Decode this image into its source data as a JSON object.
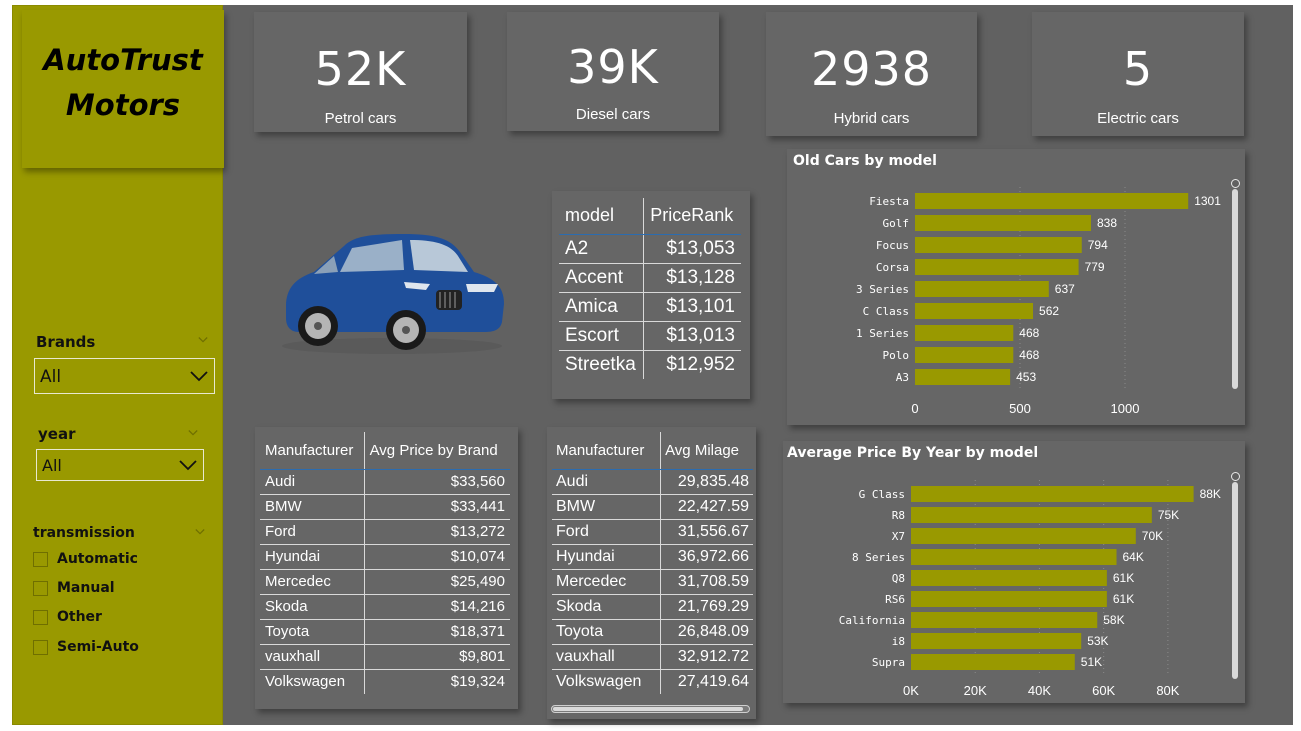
{
  "sidebar": {
    "logo_title": "AutoTrust\nMotors",
    "brands": {
      "title": "Brands",
      "value": "All"
    },
    "year": {
      "title": "year",
      "value": "All"
    },
    "transmission": {
      "title": "transmission",
      "options": [
        "Automatic",
        "Manual",
        "Other",
        "Semi-Auto"
      ]
    }
  },
  "kpis": [
    {
      "value": "52K",
      "label": "Petrol cars"
    },
    {
      "value": "39K",
      "label": "Diesel cars"
    },
    {
      "value": "2938",
      "label": "Hybrid cars"
    },
    {
      "value": "5",
      "label": "Electric cars"
    }
  ],
  "rank_table": {
    "headers": [
      "model",
      "PriceRank"
    ],
    "rows": [
      [
        "A2",
        "$13,053"
      ],
      [
        "Accent",
        "$13,128"
      ],
      [
        "Amica",
        "$13,101"
      ],
      [
        "Escort",
        "$13,013"
      ],
      [
        "Streetka",
        "$12,952"
      ]
    ]
  },
  "brand_table": {
    "headers": [
      "Manufacturer",
      "Avg Price by Brand"
    ],
    "rows": [
      [
        "Audi",
        "$33,560"
      ],
      [
        "BMW",
        "$33,441"
      ],
      [
        "Ford",
        "$13,272"
      ],
      [
        "Hyundai",
        "$10,074"
      ],
      [
        "Mercedec",
        "$25,490"
      ],
      [
        "Skoda",
        "$14,216"
      ],
      [
        "Toyota",
        "$18,371"
      ],
      [
        "vauxhall",
        "$9,801"
      ],
      [
        "Volkswagen",
        "$19,324"
      ]
    ]
  },
  "milage_table": {
    "headers": [
      "Manufacturer",
      "Avg Milage"
    ],
    "rows": [
      [
        "Audi",
        "29,835.48"
      ],
      [
        "BMW",
        "22,427.59"
      ],
      [
        "Ford",
        "31,556.67"
      ],
      [
        "Hyundai",
        "36,972.66"
      ],
      [
        "Mercedec",
        "31,708.59"
      ],
      [
        "Skoda",
        "21,769.29"
      ],
      [
        "Toyota",
        "26,848.09"
      ],
      [
        "vauxhall",
        "32,912.72"
      ],
      [
        "Volkswagen",
        "27,419.64"
      ]
    ]
  },
  "colors": {
    "accent": "#999900",
    "canvas": "#616161",
    "card": "#666666",
    "bar": "#999900"
  },
  "chart_data": [
    {
      "type": "bar",
      "orientation": "horizontal",
      "title": "Old Cars by model",
      "categories": [
        "Fiesta",
        "Golf",
        "Focus",
        "Corsa",
        "3 Series",
        "C Class",
        "1 Series",
        "Polo",
        "A3"
      ],
      "values": [
        1301,
        838,
        794,
        779,
        637,
        562,
        468,
        468,
        453
      ],
      "data_labels": [
        "1301",
        "838",
        "794",
        "779",
        "637",
        "562",
        "468",
        "468",
        "453"
      ],
      "xlim": [
        0,
        1400
      ],
      "ticks": [
        0,
        500,
        1000
      ],
      "tick_labels": [
        "0",
        "500",
        "1000"
      ],
      "grid": true
    },
    {
      "type": "bar",
      "orientation": "horizontal",
      "title": "Average Price By Year by model",
      "categories": [
        "G Class",
        "R8",
        "X7",
        "8 Series",
        "Q8",
        "RS6",
        "California",
        "i8",
        "Supra"
      ],
      "values": [
        88000,
        75000,
        70000,
        64000,
        61000,
        61000,
        58000,
        53000,
        51000
      ],
      "data_labels": [
        "88K",
        "75K",
        "70K",
        "64K",
        "61K",
        "61K",
        "58K",
        "53K",
        "51K"
      ],
      "xlim": [
        0,
        90000
      ],
      "ticks": [
        0,
        20000,
        40000,
        60000,
        80000
      ],
      "tick_labels": [
        "0K",
        "20K",
        "40K",
        "60K",
        "80K"
      ],
      "grid": true
    }
  ]
}
